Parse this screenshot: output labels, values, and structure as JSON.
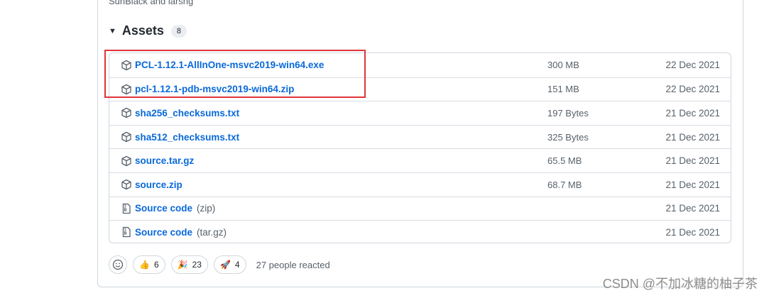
{
  "release": {
    "authors_text": "SunBlack and larsng",
    "assets_title": "Assets",
    "assets_count": "8"
  },
  "assets": [
    {
      "name": "PCL-1.12.1-AllInOne-msvc2019-win64.exe",
      "suffix": "",
      "size": "300 MB",
      "date": "22 Dec 2021",
      "icon": "package-icon"
    },
    {
      "name": "pcl-1.12.1-pdb-msvc2019-win64.zip",
      "suffix": "",
      "size": "151 MB",
      "date": "22 Dec 2021",
      "icon": "package-icon"
    },
    {
      "name": "sha256_checksums.txt",
      "suffix": "",
      "size": "197 Bytes",
      "date": "21 Dec 2021",
      "icon": "package-icon"
    },
    {
      "name": "sha512_checksums.txt",
      "suffix": "",
      "size": "325 Bytes",
      "date": "21 Dec 2021",
      "icon": "package-icon"
    },
    {
      "name": "source.tar.gz",
      "suffix": "",
      "size": "65.5 MB",
      "date": "21 Dec 2021",
      "icon": "package-icon"
    },
    {
      "name": "source.zip",
      "suffix": "",
      "size": "68.7 MB",
      "date": "21 Dec 2021",
      "icon": "package-icon"
    },
    {
      "name": "Source code",
      "suffix": "(zip)",
      "size": "",
      "date": "21 Dec 2021",
      "icon": "file-zip-icon"
    },
    {
      "name": "Source code",
      "suffix": "(tar.gz)",
      "size": "",
      "date": "21 Dec 2021",
      "icon": "file-zip-icon"
    }
  ],
  "reactions": {
    "thumbs_up": "6",
    "party": "23",
    "rocket": "4",
    "summary": "27 people reacted"
  },
  "watermark": "CSDN @不加冰糖的柚子茶",
  "colors": {
    "link": "#0969da",
    "muted": "#57606a",
    "border": "#d0d7de",
    "highlight": "#e0343a"
  }
}
